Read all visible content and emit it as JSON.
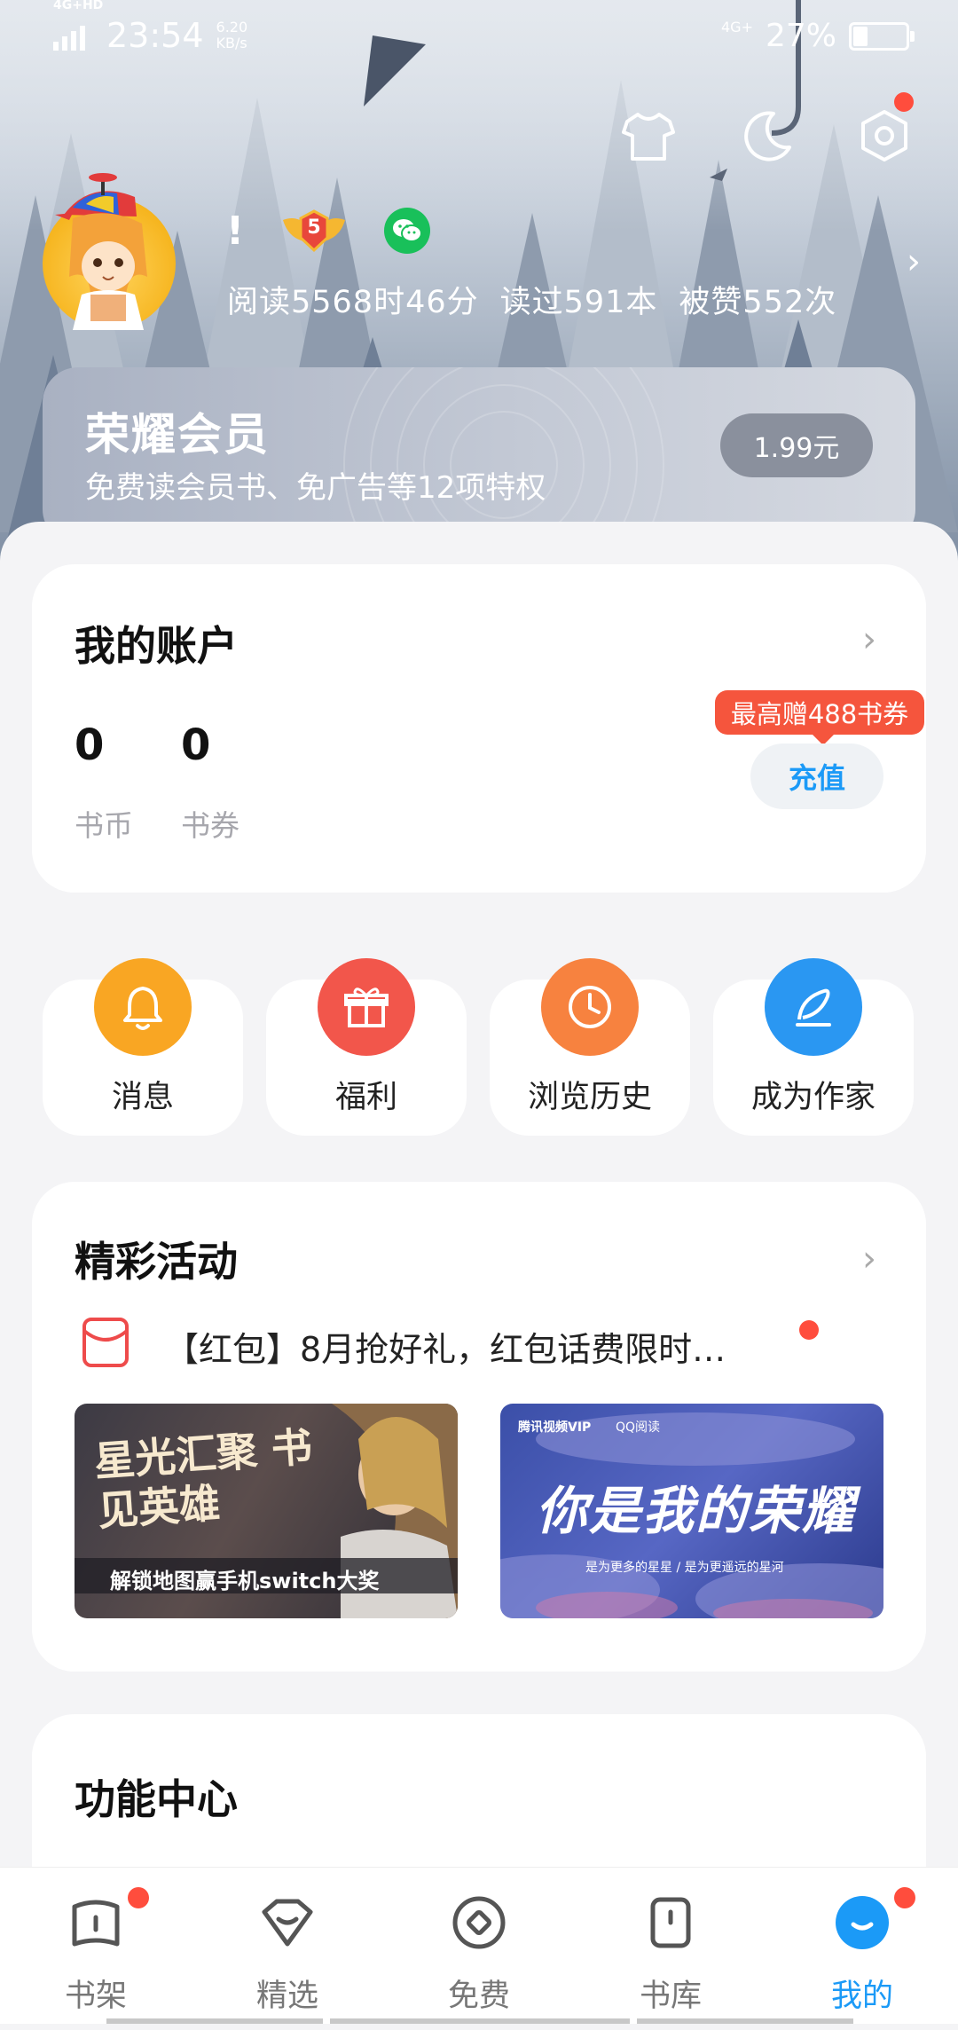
{
  "status_bar": {
    "network": "4G+HD",
    "time": "23:54",
    "speed": "6.20 KB/s",
    "network_right": "4G+",
    "battery": "27%"
  },
  "profile": {
    "alert_mark": "!",
    "level": "5",
    "reading_time": "阅读5568时46分",
    "books_read": "读过591本",
    "likes": "被赞552次"
  },
  "vip": {
    "title": "荣耀会员",
    "subtitle": "免费读会员书、免广告等12项特权",
    "price": "1.99元"
  },
  "account": {
    "title": "我的账户",
    "coins_value": "0",
    "coins_label": "书币",
    "vouchers_value": "0",
    "vouchers_label": "书券",
    "promo_tip": "最高赠488书券",
    "recharge_label": "充值"
  },
  "shortcuts": [
    {
      "label": "消息",
      "icon": "bell-icon",
      "color": "#f9a623"
    },
    {
      "label": "福利",
      "icon": "gift-icon",
      "color": "#f2564b"
    },
    {
      "label": "浏览历史",
      "icon": "clock-icon",
      "color": "#f7823f"
    },
    {
      "label": "成为作家",
      "icon": "feather-pen-icon",
      "color": "#2a97f2"
    }
  ],
  "activities": {
    "title": "精彩活动",
    "promo_text": "【红包】8月抢好礼，红包话费限时…",
    "banner1_title": "星光汇聚 书见英雄",
    "banner1_caption": "解锁地图赢手机switch大奖",
    "banner2_title": "你是我的荣耀",
    "banner2_caption": "是为更多的星星 / 是为更遥远的星河",
    "banner2_brand1": "腾讯视频VIP",
    "banner2_brand2": "QQ阅读"
  },
  "function_center": {
    "title": "功能中心"
  },
  "bottom_nav": [
    {
      "label": "书架",
      "icon": "bookshelf-icon",
      "badge": true
    },
    {
      "label": "精选",
      "icon": "featured-icon",
      "badge": false
    },
    {
      "label": "免费",
      "icon": "free-icon",
      "badge": false
    },
    {
      "label": "书库",
      "icon": "library-icon",
      "badge": false
    },
    {
      "label": "我的",
      "icon": "me-icon",
      "badge": true,
      "active": true
    }
  ],
  "colors": {
    "accent": "#1b9af7",
    "red": "#ff4d3d"
  }
}
